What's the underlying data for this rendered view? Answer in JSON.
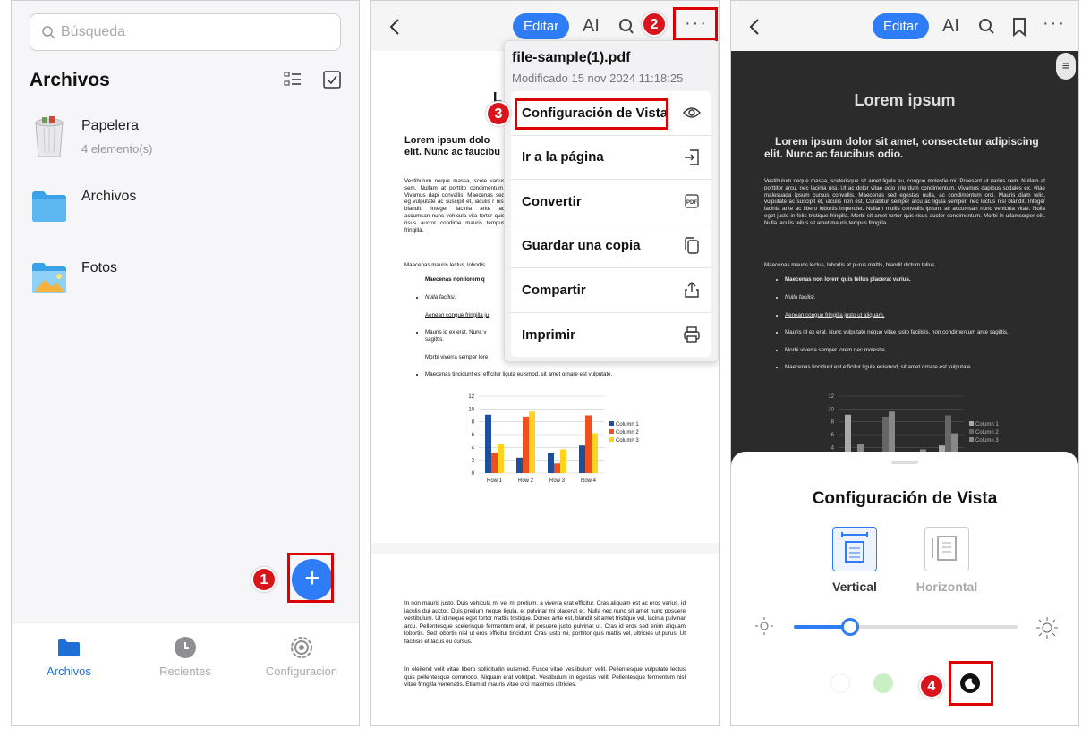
{
  "panel1": {
    "search_placeholder": "Búsqueda",
    "title": "Archivos",
    "items": [
      {
        "name": "Papelera",
        "sub": "4 elemento(s)",
        "icon": "trash-icon"
      },
      {
        "name": "Archivos",
        "sub": "",
        "icon": "folder-icon"
      },
      {
        "name": "Fotos",
        "sub": "",
        "icon": "photos-folder-icon"
      }
    ],
    "tabs": [
      "Archivos",
      "Recientes",
      "Configuración"
    ],
    "step": "1"
  },
  "panel2": {
    "edit_label": "Editar",
    "ai_label": "AI",
    "step2": "2",
    "step3": "3",
    "menu": {
      "file_name": "file-sample(1).pdf",
      "modified": "Modificado 15 nov 2024 11:18:25",
      "items": [
        "Configuración de Vista",
        "Ir a la página",
        "Convertir",
        "Guardar una copia",
        "Compartir",
        "Imprimir"
      ]
    },
    "pdf": {
      "title_fragment": "L",
      "subtitle_fragment": "Lorem ipsum dolo\nelit. Nunc ac faucibu",
      "para1": "Vestibulum neque massa, scele varius sem. Nullam at porttito condimentum. Vivamus dapi convallis. Maecenas sed eg vulputate ac suscipit et, iaculis r nisl blandit. Integer lacinia ante ac accumsan nunc vehicula vita tortor quis risus auctor condime mauris tempus fringilla.",
      "para2": "Maecenas mauris lectus, lobortis",
      "bullets": [
        "Maecenas non lorem q",
        "Nulla facilisi.",
        "Aenean congue fringilla ju",
        "Mauris id ex erat. Nunc v sagittis.",
        "Morbi viverra semper lore",
        "Maecenas tincidunt est efficitur ligula euismod, sit amet ornare est vulputate."
      ],
      "page2_para1": "In non mauris justo. Duis vehicula mi vel mi pretium, a viverra erat efficitur. Cras aliquam est ac eros varius, id iaculis dui auctor. Duis pretium neque ligula, et pulvinar mi placerat et. Nulla nec nunc sit amet nunc posuere vestibulum. Ut id neque eget tortor mattis tristique. Donec ante est, blandit sit amet tristique vel, lacinia pulvinar arcu. Pellentesque scelerisque fermentum erat, id posuere justo pulvinar ut. Cras id eros sed enim aliquam lobortis. Sed lobortis nisl ut eros efficitur tincidunt. Cras justo mi, porttitor quis mattis vel, ultricies ut purus. Ut facilisis et lacus eu cursus.",
      "page2_para2": "In eleifend velit vitae libero sollicitudin euismod. Fusce vitae vestibulum velit. Pellentesque vulputate lectus quis pellentesque commodo. Aliquam erat volutpat. Vestibulum in egestas velit. Pellentesque fermentum nisl vitae fringilla venenatis. Etiam id mauris vitae orci maximus ultricies."
    }
  },
  "panel3": {
    "edit_label": "Editar",
    "ai_label": "AI",
    "pdf": {
      "title": "Lorem ipsum",
      "subtitle": "Lorem ipsum dolor sit amet, consectetur adipiscing elit. Nunc ac faucibus odio.",
      "para1": "Vestibulum neque massa, scelerisque sit amet ligula eu, congue molestie mi. Praesent ut varius sem. Nullam at porttitor arcu, nec lacinia nisi. Ut ac dolor vitae odio interdum condimentum. Vivamus dapibus sodales ex, vitae malesuada ipsum cursus convallis. Maecenas sed egestas nulla, ac condimentum orci. Mauris diam felis, vulputate ac suscipit et, iaculis non est. Curabitur semper arcu ac ligula semper, nec luctus nisl blandit. Integer lacinia ante ac libero lobortis imperdiet. Nullam mollis convallis ipsum, ac accumsan nunc vehicula vitae. Nulla eget justo in felis tristique fringilla. Morbi sit amet tortor quis risus auctor condimentum. Morbi in ullamcorper elit. Nulla iaculis tellus sit amet mauris tempus fringilla.",
      "para2": "Maecenas mauris lectus, lobortis et purus mattis, blandit dictum tellus.",
      "bullets": [
        "Maecenas non lorem quis tellus placerat varius.",
        "Nulla facilisi.",
        "Aenean congue fringilla justo ut aliquam.",
        "Mauris id ex erat. Nunc vulputate neque vitae justo facilisis, non condimentum ante sagittis.",
        "Morbi viverra semper lorem nec molestie.",
        "Maecenas tincidunt est efficitur ligula euismod, sit amet ornare est vulputate."
      ]
    },
    "sheet": {
      "title": "Configuración de Vista",
      "vertical": "Vertical",
      "horizontal": "Horizontal",
      "brightness": 0.25
    },
    "step4": "4"
  },
  "chart_data": {
    "type": "bar",
    "categories": [
      "Row 1",
      "Row 2",
      "Row 3",
      "Row 4"
    ],
    "series": [
      {
        "name": "Column 1",
        "values": [
          9.1,
          2.4,
          3.1,
          4.3
        ],
        "color": "#1f4e9a"
      },
      {
        "name": "Column 2",
        "values": [
          3.2,
          8.8,
          1.5,
          9.0
        ],
        "color": "#f0501e"
      },
      {
        "name": "Column 3",
        "values": [
          4.5,
          9.6,
          3.7,
          6.2
        ],
        "color": "#ffd320"
      }
    ],
    "ylim": [
      0,
      12
    ],
    "yticks": [
      "0",
      "2",
      "4",
      "6",
      "8",
      "10",
      "12"
    ],
    "legend": "right",
    "grid": true
  }
}
